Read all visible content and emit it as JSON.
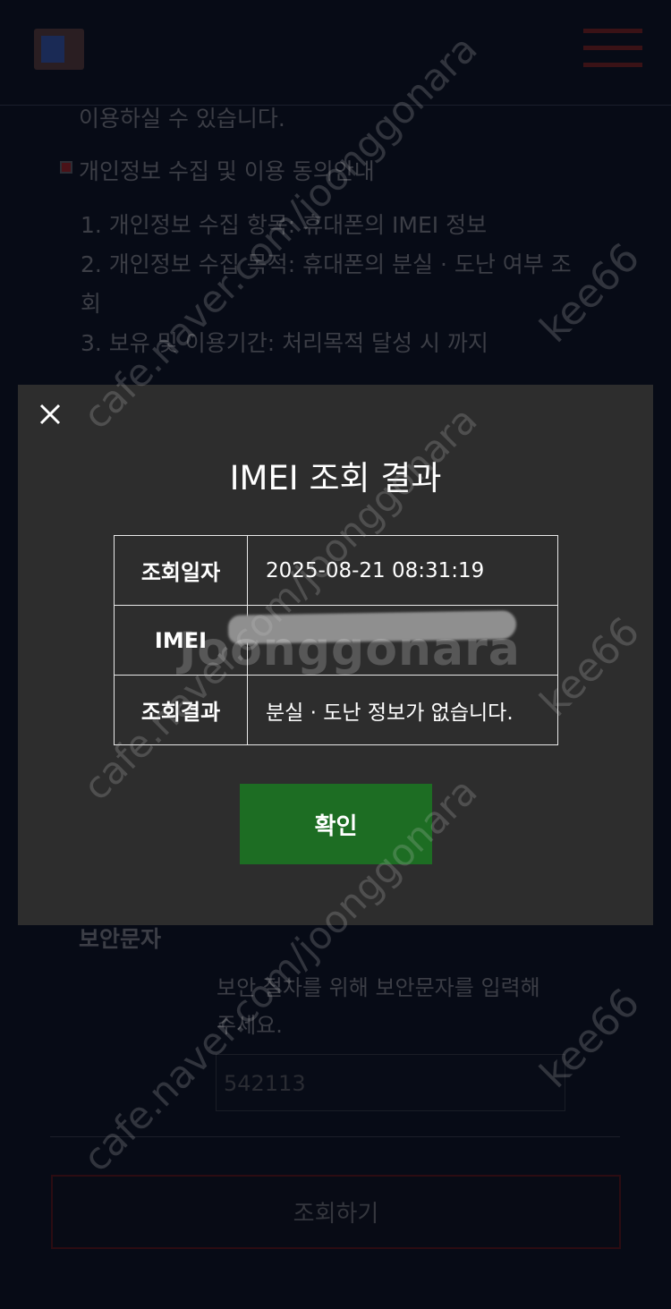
{
  "background_page": {
    "header": {
      "logo_icon": "logo-mark",
      "menu_icon": "hamburger-menu-icon"
    },
    "intro_text_tail": "이용하실 수 있습니다.",
    "consent": {
      "heading": "개인정보 수집 및 이용 동의안내",
      "items": [
        "1. 개인정보 수집 항목: 휴대폰의 IMEI 정보",
        "2. 개인정보 수집 목적: 휴대폰의 분실 · 도난 여부 조",
        "회",
        "3. 보유 및 이용기간: 처리목적 달성 시 까지"
      ]
    },
    "security": {
      "label": "보안문자",
      "hint_line1": "보안 절차를 위해 보안문자를 입력해",
      "hint_line2": "주세요.",
      "input_value": "542113"
    },
    "submit_label": "조회하기"
  },
  "modal": {
    "close_icon": "close-icon",
    "title": "IMEI 조회 결과",
    "rows": [
      {
        "label": "조회일자",
        "value": "2025-08-21 08:31:19"
      },
      {
        "label": "IMEI",
        "value": ""
      },
      {
        "label": "조회결과",
        "value": "분실 · 도난 정보가 없습니다."
      }
    ],
    "confirm_label": "확인"
  },
  "watermarks": {
    "cafe": "cafe.naver.com/joonggonara",
    "kee": "kee66",
    "brand": "Joonggonara"
  },
  "colors": {
    "page_background": "#070b16",
    "modal_background": "#2d2d2d",
    "confirm_button": "#1d6d23",
    "submit_border": "#2c0c12"
  }
}
